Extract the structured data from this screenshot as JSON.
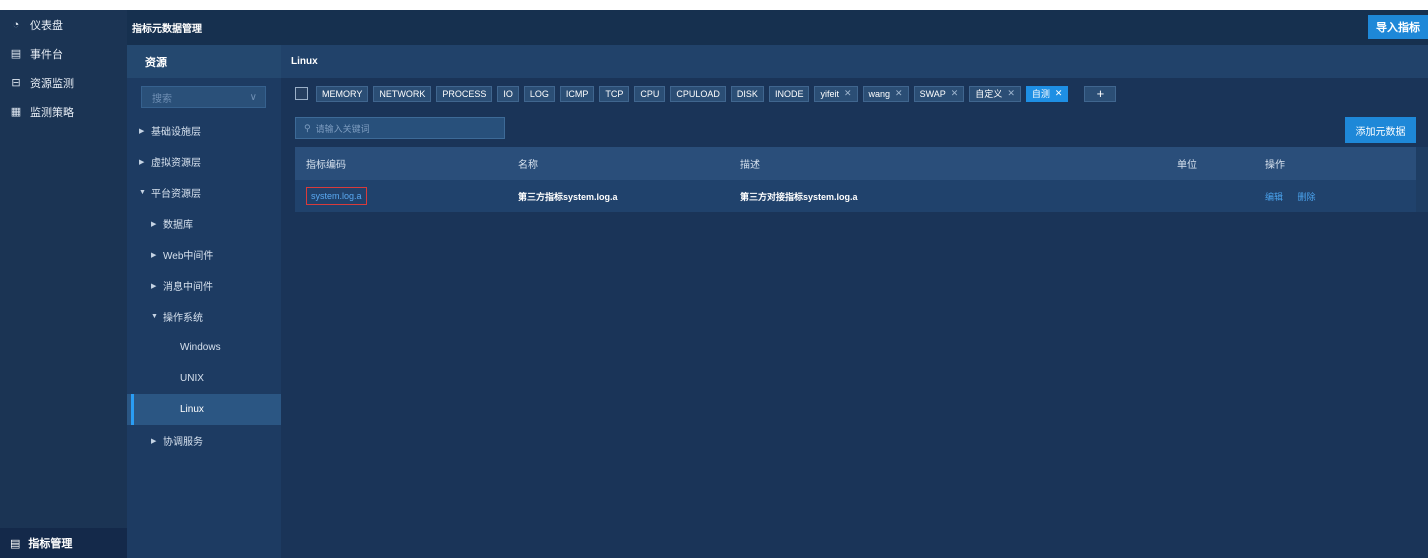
{
  "nav": {
    "items": [
      {
        "icon": "◔",
        "icon_name": "dashboard-icon",
        "label": "仪表盘"
      },
      {
        "icon": "▤",
        "icon_name": "event-icon",
        "label": "事件台"
      },
      {
        "icon": "⊟",
        "icon_name": "monitor-icon",
        "label": "资源监测"
      },
      {
        "icon": "▦",
        "icon_name": "strategy-icon",
        "label": "监测策略"
      }
    ],
    "active": {
      "icon": "▤",
      "icon_name": "metrics-icon",
      "label": "指标管理"
    }
  },
  "header": {
    "title": "指标元数据管理",
    "import_label": "导入指标"
  },
  "tree": {
    "title": "资源",
    "search_placeholder": "搜索",
    "search_chevron": "∨",
    "items": [
      {
        "label": "基础设施层",
        "level": 0,
        "arrow": "▶"
      },
      {
        "label": "虚拟资源层",
        "level": 0,
        "arrow": "▶"
      },
      {
        "label": "平台资源层",
        "level": 0,
        "arrow": "▼"
      },
      {
        "label": "数据库",
        "level": 1,
        "arrow": "▶"
      },
      {
        "label": "Web中间件",
        "level": 1,
        "arrow": "▶"
      },
      {
        "label": "消息中间件",
        "level": 1,
        "arrow": "▶"
      },
      {
        "label": "操作系统",
        "level": 1,
        "arrow": "▼"
      },
      {
        "label": "Windows",
        "level": 2,
        "arrow": ""
      },
      {
        "label": "UNIX",
        "level": 2,
        "arrow": ""
      },
      {
        "label": "Linux",
        "level": 2,
        "arrow": "",
        "selected": true
      },
      {
        "label": "协调服务",
        "level": 1,
        "arrow": "▶"
      }
    ]
  },
  "main": {
    "title": "Linux",
    "tags": [
      {
        "label": "MEMORY"
      },
      {
        "label": "NETWORK"
      },
      {
        "label": "PROCESS"
      },
      {
        "label": "IO"
      },
      {
        "label": "LOG"
      },
      {
        "label": "ICMP"
      },
      {
        "label": "TCP"
      },
      {
        "label": "CPU"
      },
      {
        "label": "CPULOAD"
      },
      {
        "label": "DISK"
      },
      {
        "label": "INODE"
      },
      {
        "label": "yifeit",
        "closable": true
      },
      {
        "label": "wang",
        "closable": true
      },
      {
        "label": "SWAP",
        "closable": true
      },
      {
        "label": "自定义",
        "closable": true
      },
      {
        "label": "自测",
        "closable": true,
        "active": true
      }
    ],
    "tag_add": "+",
    "keyword_placeholder": "请输入关键词",
    "add_label": "添加元数据",
    "table": {
      "headers": [
        "指标编码",
        "名称",
        "描述",
        "单位",
        "操作"
      ],
      "rows": [
        {
          "code": "system.log.a",
          "name": "第三方指标system.log.a",
          "desc": "第三方对接指标system.log.a",
          "unit": "",
          "edit": "编辑",
          "delete": "删除"
        }
      ]
    }
  },
  "colors": {
    "accent": "#1e88d8",
    "nav_bg": "#1b3454",
    "panel_bg": "#1a3458",
    "highlight_border": "#d83b3b"
  }
}
